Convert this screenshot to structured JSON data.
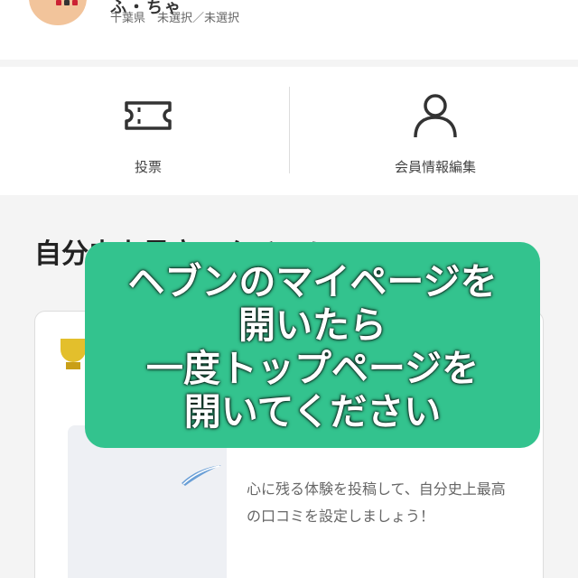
{
  "profile": {
    "username": "ふ・ちゃ",
    "region": "千葉県　未選択／未選択"
  },
  "actions": {
    "vote_label": "投票",
    "member_edit_label": "会員情報編集"
  },
  "section": {
    "title": "自分史上最高のクチコミ"
  },
  "review_card": {
    "prompt_text": "心に残る体験を投稿して、自分史上最高の口コミを設定しましょう！"
  },
  "overlay": {
    "lines": [
      "ヘブンのマイページを",
      "開いたら",
      "一度トップページを",
      "開いてください"
    ]
  },
  "colors": {
    "overlay_bg": "#33c38e",
    "trophy": "#e3bf2c"
  }
}
